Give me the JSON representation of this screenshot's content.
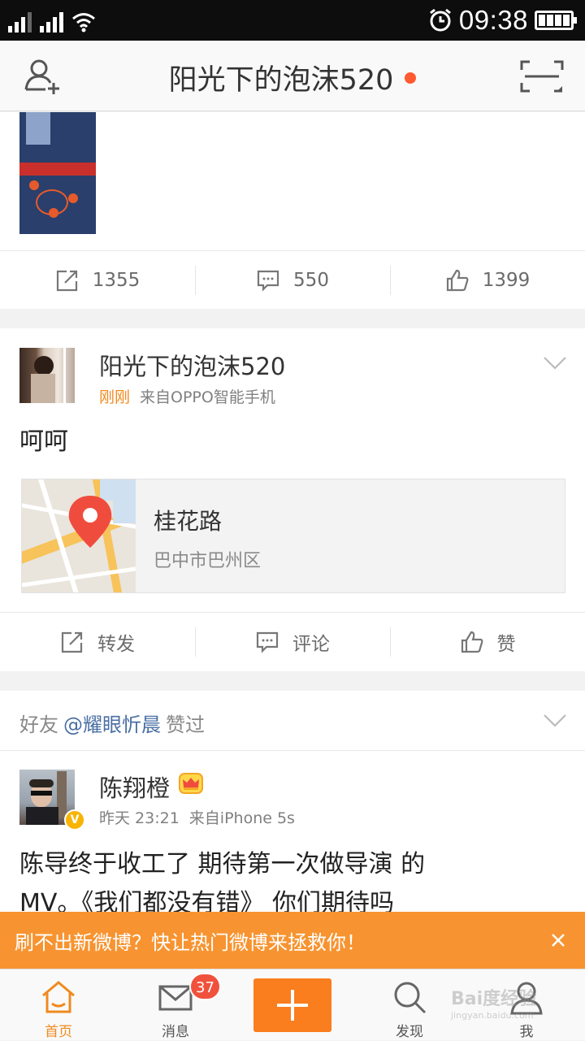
{
  "status_bar": {
    "time": "09:38"
  },
  "header": {
    "title": "阳光下的泡沫520"
  },
  "post_top": {
    "repost_count": "1355",
    "comment_count": "550",
    "like_count": "1399"
  },
  "post_main": {
    "author": "阳光下的泡沫520",
    "time": "刚刚",
    "source": "来自OPPO智能手机",
    "text": "呵呵",
    "location": {
      "place": "桂花路",
      "area": "巴中市巴州区"
    },
    "actions": {
      "repost": "转发",
      "comment": "评论",
      "like": "赞"
    }
  },
  "post_liked": {
    "prefix": "好友",
    "friend": "@耀眼忻晨",
    "suffix": "赞过",
    "author": "陈翔橙",
    "verified_mark": "V",
    "time": "昨天 23:21",
    "source": "来自iPhone 5s",
    "text_line1": "陈导终于收工了 期待第一次做导演 的",
    "text_line2": "MV。《我们都没有错》 你们期待吗"
  },
  "banner": {
    "message": "刷不出新微博？快让热门微博来拯救你！"
  },
  "tabbar": {
    "home": "首页",
    "messages": "消息",
    "messages_badge": "37",
    "discover": "发现",
    "me": "我"
  },
  "watermark": {
    "brand": "Bai度经验",
    "url": "jingyan.baidu.com"
  },
  "colors": {
    "accent": "#fa7d1e",
    "banner": "#f79431",
    "live_dot": "#ff5a30",
    "badge": "#f0513c",
    "link": "#4a6fa3"
  }
}
